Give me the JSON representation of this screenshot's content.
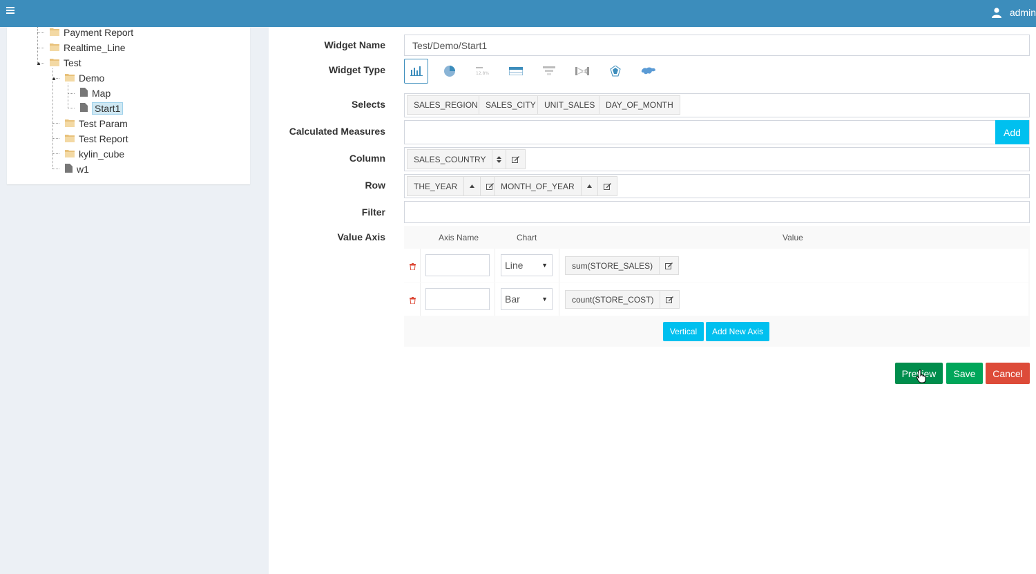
{
  "topbar": {
    "user": "admin",
    "menu_icon": "hamburger-icon",
    "user_icon": "user-icon",
    "color": "#3c8dbc"
  },
  "tree": {
    "items": [
      {
        "label": "Payment Report",
        "icon": "folder-icon"
      },
      {
        "label": "Realtime_Line",
        "icon": "folder-icon"
      },
      {
        "label": "Test",
        "icon": "folder-icon"
      },
      {
        "label": "Demo",
        "icon": "folder-icon"
      },
      {
        "label": "Map",
        "icon": "file-icon"
      },
      {
        "label": "Start1",
        "icon": "file-icon",
        "selected": true
      },
      {
        "label": "Test Param",
        "icon": "folder-icon"
      },
      {
        "label": "Test Report",
        "icon": "folder-icon"
      },
      {
        "label": "kylin_cube",
        "icon": "folder-icon"
      },
      {
        "label": "w1",
        "icon": "file-icon"
      }
    ]
  },
  "form": {
    "widget_name_label": "Widget Name",
    "widget_name_value": "Test/Demo/Start1",
    "widget_type_label": "Widget Type",
    "widget_types": [
      "bar-chart-icon",
      "pie-chart-icon",
      "kpi-icon",
      "table-icon",
      "funnel-icon",
      "sankey-icon",
      "radar-icon",
      "map-icon"
    ],
    "selects_label": "Selects",
    "selects": [
      "SALES_REGION",
      "SALES_CITY",
      "UNIT_SALES",
      "DAY_OF_MONTH"
    ],
    "calc_label": "Calculated Measures",
    "add_label": "Add",
    "column_label": "Column",
    "column_items": [
      "SALES_COUNTRY"
    ],
    "row_label": "Row",
    "row_items": [
      "THE_YEAR",
      "MONTH_OF_YEAR"
    ],
    "filter_label": "Filter",
    "value_axis_label": "Value Axis",
    "value_axis": {
      "headers": {
        "axis_name": "Axis Name",
        "chart": "Chart",
        "value": "Value"
      },
      "rows": [
        {
          "axis_name": "",
          "chart": "Line",
          "value": "sum(STORE_SALES)"
        },
        {
          "axis_name": "",
          "chart": "Bar",
          "value": "count(STORE_COST)"
        }
      ],
      "vertical_label": "Vertical",
      "add_axis_label": "Add New Axis"
    },
    "preview_label": "Preview",
    "save_label": "Save",
    "cancel_label": "Cancel"
  }
}
